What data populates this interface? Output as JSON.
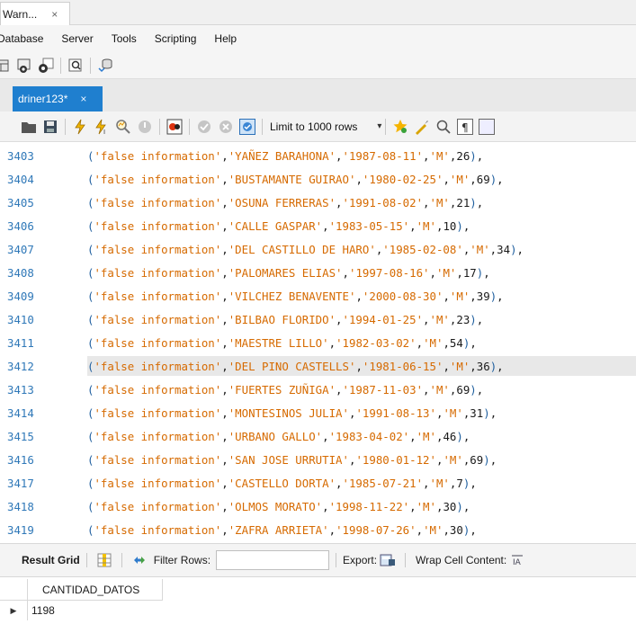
{
  "window_tab": {
    "label": "Warn...",
    "close": "×"
  },
  "menu": [
    "Database",
    "Server",
    "Tools",
    "Scripting",
    "Help"
  ],
  "editor_tab": {
    "label": "driner123*",
    "close": "×"
  },
  "editor_toolbar": {
    "limit_label": "Limit to 1000 rows",
    "limit_arrow": "▾"
  },
  "editor": {
    "highlighted_line": "3412",
    "lines": [
      {
        "n": "3403",
        "info": "'false information'",
        "name": "'YAÑEZ BARAHONA'",
        "date": "'1987-08-11'",
        "sex": "'M'",
        "num": "26"
      },
      {
        "n": "3404",
        "info": "'false information'",
        "name": "'BUSTAMANTE GUIRAO'",
        "date": "'1980-02-25'",
        "sex": "'M'",
        "num": "69"
      },
      {
        "n": "3405",
        "info": "'false information'",
        "name": "'OSUNA FERRERAS'",
        "date": "'1991-08-02'",
        "sex": "'M'",
        "num": "21"
      },
      {
        "n": "3406",
        "info": "'false information'",
        "name": "'CALLE GASPAR'",
        "date": "'1983-05-15'",
        "sex": "'M'",
        "num": "10"
      },
      {
        "n": "3407",
        "info": "'false information'",
        "name": "'DEL CASTILLO DE HARO'",
        "date": "'1985-02-08'",
        "sex": "'M'",
        "num": "34"
      },
      {
        "n": "3408",
        "info": "'false information'",
        "name": "'PALOMARES ELIAS'",
        "date": "'1997-08-16'",
        "sex": "'M'",
        "num": "17"
      },
      {
        "n": "3409",
        "info": "'false information'",
        "name": "'VILCHEZ BENAVENTE'",
        "date": "'2000-08-30'",
        "sex": "'M'",
        "num": "39"
      },
      {
        "n": "3410",
        "info": "'false information'",
        "name": "'BILBAO FLORIDO'",
        "date": "'1994-01-25'",
        "sex": "'M'",
        "num": "23"
      },
      {
        "n": "3411",
        "info": "'false information'",
        "name": "'MAESTRE LILLO'",
        "date": "'1982-03-02'",
        "sex": "'M'",
        "num": "54"
      },
      {
        "n": "3412",
        "info": "'false information'",
        "name": "'DEL PINO CASTELLS'",
        "date": "'1981-06-15'",
        "sex": "'M'",
        "num": "36"
      },
      {
        "n": "3413",
        "info": "'false information'",
        "name": "'FUERTES ZUÑIGA'",
        "date": "'1987-11-03'",
        "sex": "'M'",
        "num": "69"
      },
      {
        "n": "3414",
        "info": "'false information'",
        "name": "'MONTESINOS JULIA'",
        "date": "'1991-08-13'",
        "sex": "'M'",
        "num": "31"
      },
      {
        "n": "3415",
        "info": "'false information'",
        "name": "'URBANO GALLO'",
        "date": "'1983-04-02'",
        "sex": "'M'",
        "num": "46"
      },
      {
        "n": "3416",
        "info": "'false information'",
        "name": "'SAN JOSE URRUTIA'",
        "date": "'1980-01-12'",
        "sex": "'M'",
        "num": "69"
      },
      {
        "n": "3417",
        "info": "'false information'",
        "name": "'CASTELLO DORTA'",
        "date": "'1985-07-21'",
        "sex": "'M'",
        "num": "7"
      },
      {
        "n": "3418",
        "info": "'false information'",
        "name": "'OLMOS MORATO'",
        "date": "'1998-11-22'",
        "sex": "'M'",
        "num": "30"
      },
      {
        "n": "3419",
        "info": "'false information'",
        "name": "'ZAFRA ARRIETA'",
        "date": "'1998-07-26'",
        "sex": "'M'",
        "num": "30"
      }
    ]
  },
  "result_toolbar": {
    "result_grid": "Result Grid",
    "filter_rows": "Filter Rows:",
    "export": "Export:",
    "wrap": "Wrap Cell Content:"
  },
  "result_grid": {
    "column": "CANTIDAD_DATOS",
    "row_marker": "▶",
    "value": "1198"
  },
  "colors": {
    "accent_tab": "#1f7fcf",
    "string": "#d66a00",
    "line_number": "#2f78b8"
  }
}
